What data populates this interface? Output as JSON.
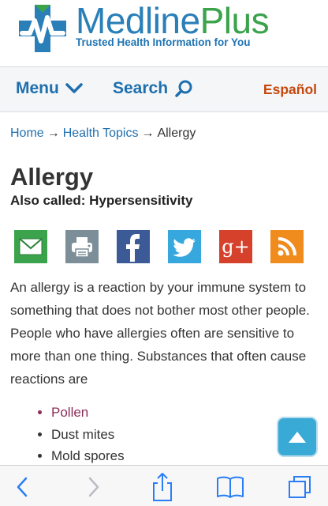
{
  "logo": {
    "word_medline": "Medline",
    "word_plus": "Plus",
    "tagline": "Trusted Health Information for You"
  },
  "nav": {
    "menu_label": "Menu",
    "search_label": "Search",
    "espanol_label": "Español"
  },
  "breadcrumb": {
    "home": "Home",
    "separator": "→",
    "health_topics": "Health Topics",
    "current": "Allergy"
  },
  "page": {
    "title": "Allergy",
    "also_called": "Also called: Hypersensitivity",
    "intro": "An allergy is a reaction by your immune system to something that does not bother most other people. People who have allergies often are sensitive to more than one thing. Substances that often cause reactions are",
    "bullets": [
      "Pollen",
      "Dust mites",
      "Mold spores"
    ]
  },
  "share": {
    "icons": [
      "email-icon",
      "print-icon",
      "facebook-icon",
      "twitter-icon",
      "google-plus-icon",
      "rss-icon"
    ],
    "google_text": "g+"
  },
  "colors": {
    "brand_blue": "#1f6fae",
    "brand_green": "#3aa34b",
    "espanol_orange": "#c5480f",
    "link_maroon": "#8b2d55",
    "top_button": "#39a9d6",
    "ios_blue": "#2a7ef5"
  },
  "toolbar": {
    "icons": [
      "back-icon",
      "forward-icon",
      "share-icon",
      "bookmarks-icon",
      "tabs-icon"
    ]
  }
}
